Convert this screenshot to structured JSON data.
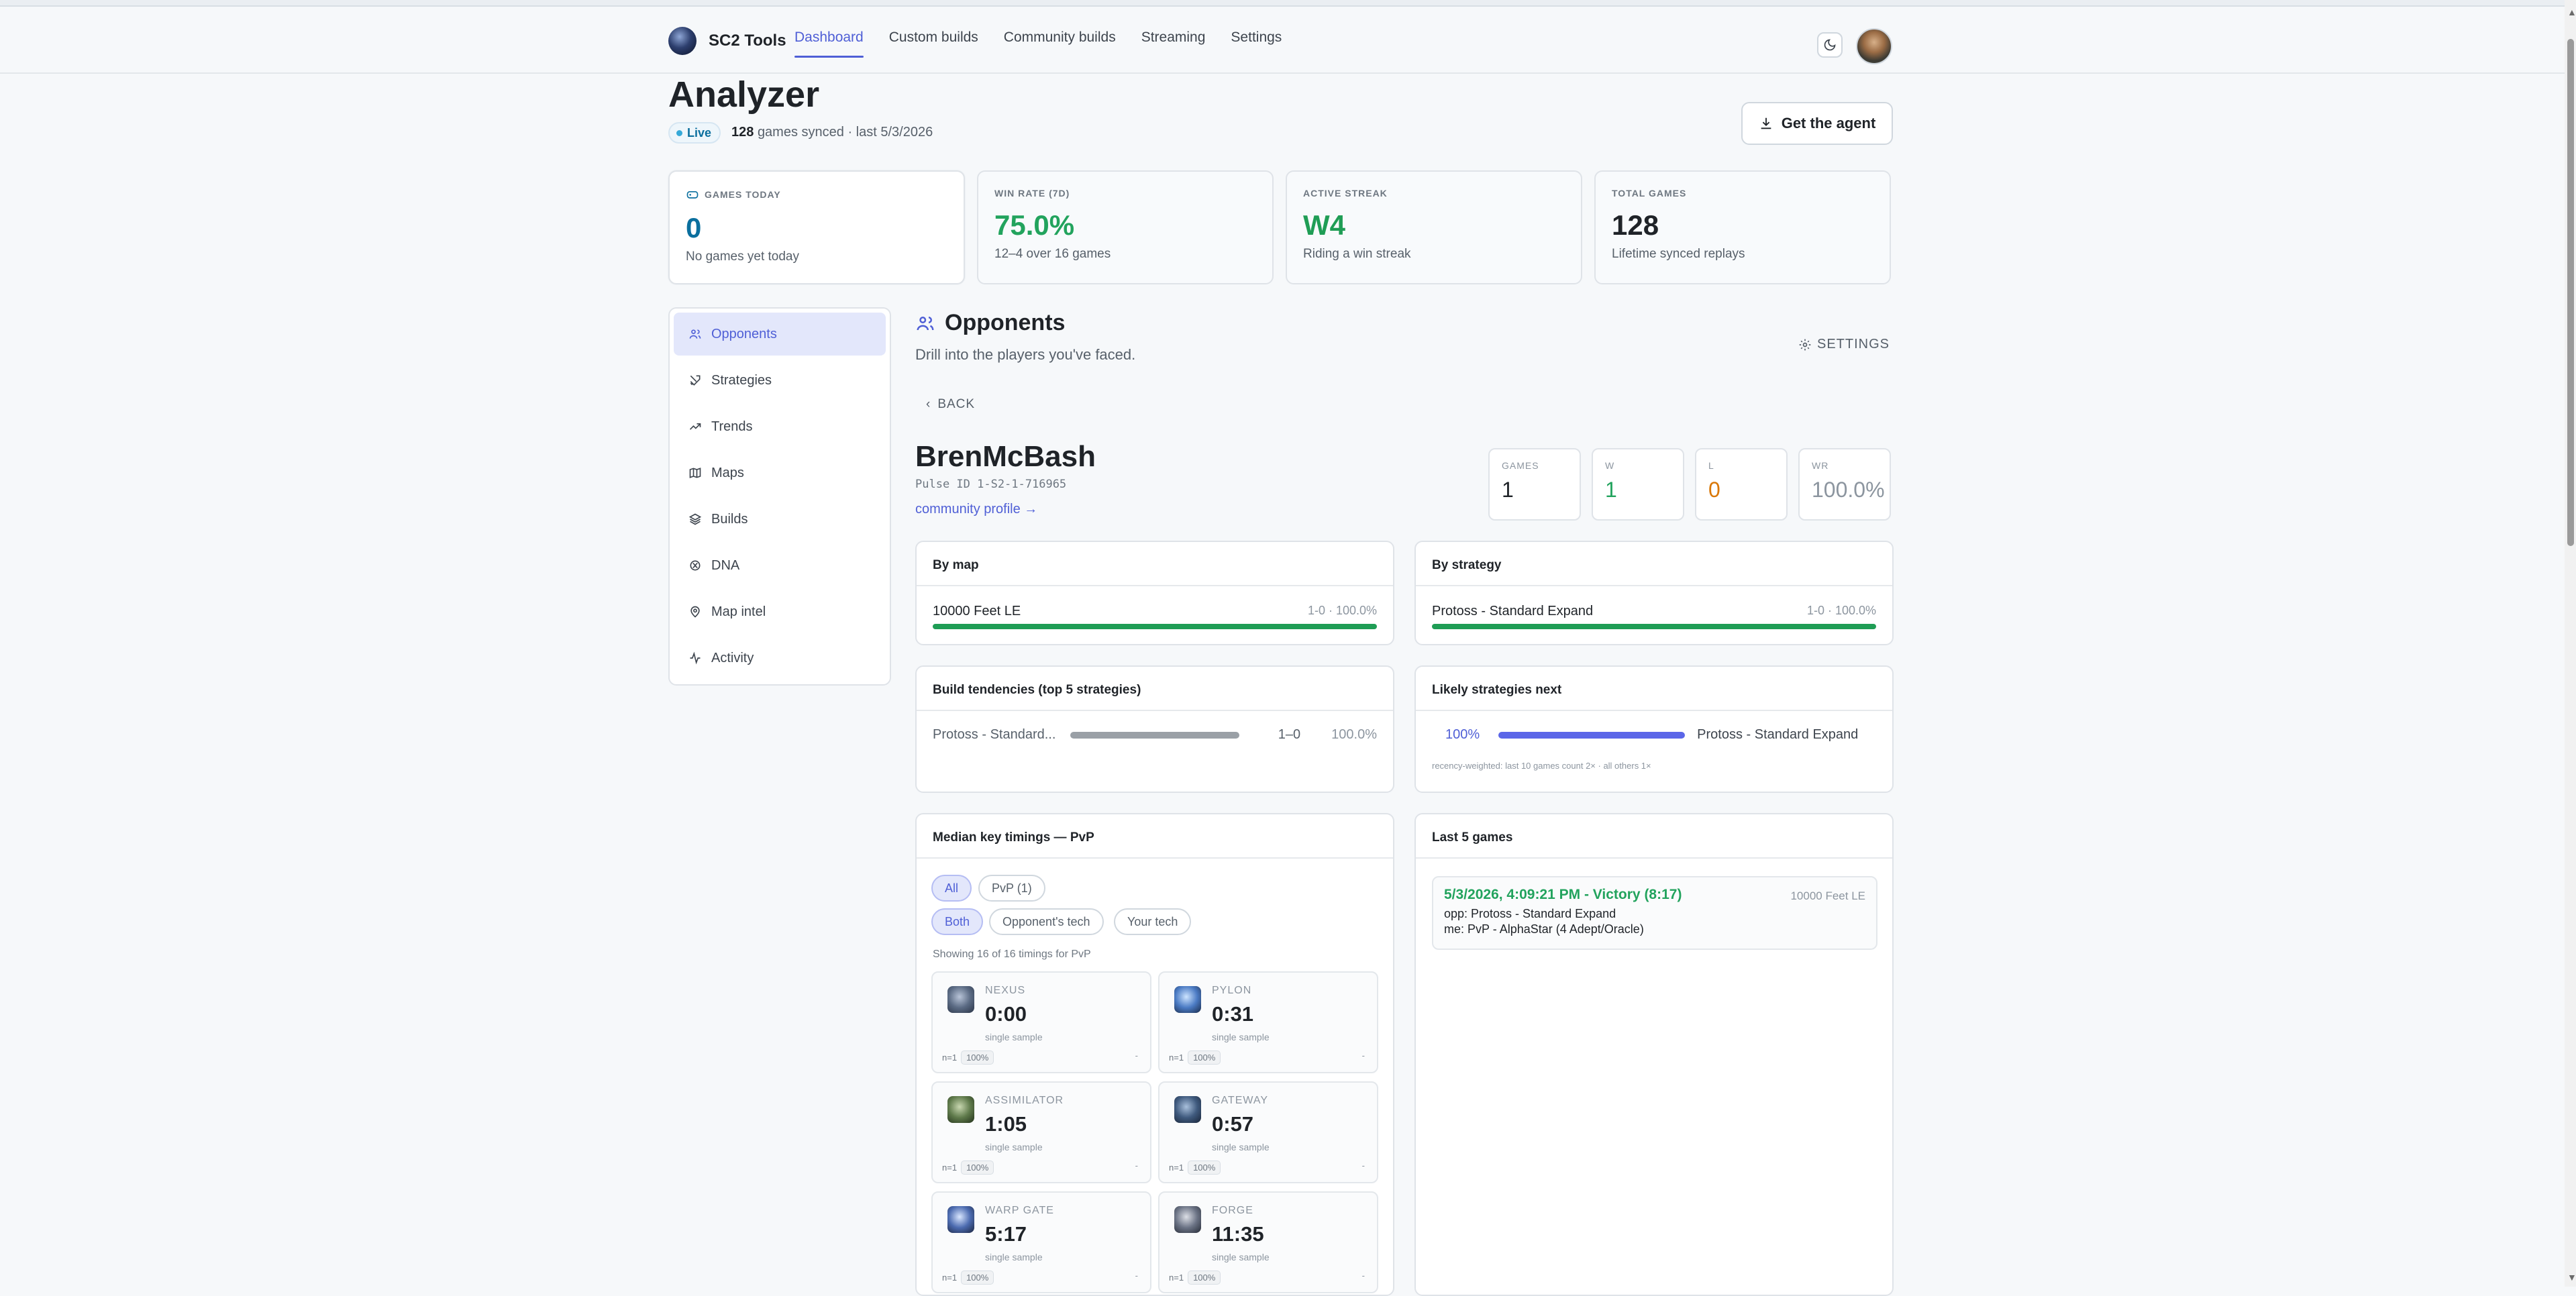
{
  "app": {
    "name": "SC2 Tools"
  },
  "nav": {
    "items": [
      "Dashboard",
      "Custom builds",
      "Community builds",
      "Streaming",
      "Settings"
    ],
    "active": "Dashboard"
  },
  "page": {
    "title": "Analyzer",
    "live_label": "Live",
    "synced_count": "128",
    "synced_suffix": "games synced · last 5/3/2026",
    "agent_button": "Get the agent"
  },
  "kpis": [
    {
      "label": "GAMES TODAY",
      "value": "0",
      "sub": "No games yet today",
      "color": "#0b6f9e"
    },
    {
      "label": "WIN RATE (7D)",
      "value": "75.0%",
      "sub": "12–4 over 16 games",
      "color": "#22a35d"
    },
    {
      "label": "ACTIVE STREAK",
      "value": "W4",
      "sub": "Riding a win streak",
      "color": "#1f9d55"
    },
    {
      "label": "TOTAL GAMES",
      "value": "128",
      "sub": "Lifetime synced replays",
      "color": "#1f2328"
    }
  ],
  "sidebar": {
    "items": [
      {
        "label": "Opponents",
        "icon": "users-icon",
        "active": true
      },
      {
        "label": "Strategies",
        "icon": "swords-icon"
      },
      {
        "label": "Trends",
        "icon": "trend-icon"
      },
      {
        "label": "Maps",
        "icon": "map-icon"
      },
      {
        "label": "Builds",
        "icon": "layers-icon"
      },
      {
        "label": "DNA",
        "icon": "dna-icon"
      },
      {
        "label": "Map intel",
        "icon": "pin-icon"
      },
      {
        "label": "Activity",
        "icon": "activity-icon"
      }
    ]
  },
  "section": {
    "title": "Opponents",
    "subtitle": "Drill into the players you've faced.",
    "settings_label": "SETTINGS",
    "back_label": "BACK"
  },
  "opponent": {
    "name": "BrenMcBash",
    "pulse_id": "Pulse ID 1-S2-1-716965",
    "profile_link": "community profile →"
  },
  "stats": [
    {
      "label": "GAMES",
      "value": "1",
      "color": "#1f2328"
    },
    {
      "label": "W",
      "value": "1",
      "color": "#22a35d"
    },
    {
      "label": "L",
      "value": "0",
      "color": "#d97706"
    },
    {
      "label": "WR",
      "value": "100.0%",
      "color": "#8c959f"
    }
  ],
  "by_map": {
    "title": "By map",
    "row": {
      "name": "10000 Feet LE",
      "record": "1-0 · 100.0%",
      "fraction": 1.0
    }
  },
  "by_strategy": {
    "title": "By strategy",
    "row": {
      "name": "Protoss - Standard Expand",
      "record": "1-0 · 100.0%",
      "fraction": 1.0
    }
  },
  "build_tendencies": {
    "title": "Build tendencies (top 5 strategies)",
    "row": {
      "name": "Protoss - Standard...",
      "record": "1–0",
      "pct": "100.0%",
      "fraction": 1.0
    }
  },
  "likely_next": {
    "title": "Likely strategies next",
    "row": {
      "pct": "100%",
      "name": "Protoss - Standard Expand",
      "fraction": 1.0
    },
    "note": "recency-weighted: last 10 games count 2× · all others 1×"
  },
  "timings": {
    "title": "Median key timings — PvP",
    "filters1": [
      "All",
      "PvP (1)"
    ],
    "filters2": [
      "Both",
      "Opponent's tech",
      "Your tech"
    ],
    "showing": "Showing 16 of 16 timings for PvP",
    "tiles": [
      {
        "name": "NEXUS",
        "time": "0:00",
        "sample": "single sample",
        "n": "n=1",
        "pct": "100%",
        "dash": "-"
      },
      {
        "name": "PYLON",
        "time": "0:31",
        "sample": "single sample",
        "n": "n=1",
        "pct": "100%",
        "dash": "-"
      },
      {
        "name": "ASSIMILATOR",
        "time": "1:05",
        "sample": "single sample",
        "n": "n=1",
        "pct": "100%",
        "dash": "-"
      },
      {
        "name": "GATEWAY",
        "time": "0:57",
        "sample": "single sample",
        "n": "n=1",
        "pct": "100%",
        "dash": "-"
      },
      {
        "name": "WARP GATE",
        "time": "5:17",
        "sample": "single sample",
        "n": "n=1",
        "pct": "100%",
        "dash": "-"
      },
      {
        "name": "FORGE",
        "time": "11:35",
        "sample": "single sample",
        "n": "n=1",
        "pct": "100%",
        "dash": "-"
      }
    ]
  },
  "last_games": {
    "title": "Last 5 games",
    "games": [
      {
        "title": "5/3/2026, 4:09:21 PM - Victory (8:17)",
        "map": "10000 Feet LE",
        "opp": "opp: Protoss - Standard Expand",
        "me": "me: PvP - AlphaStar (4 Adept/Oracle)"
      }
    ]
  }
}
